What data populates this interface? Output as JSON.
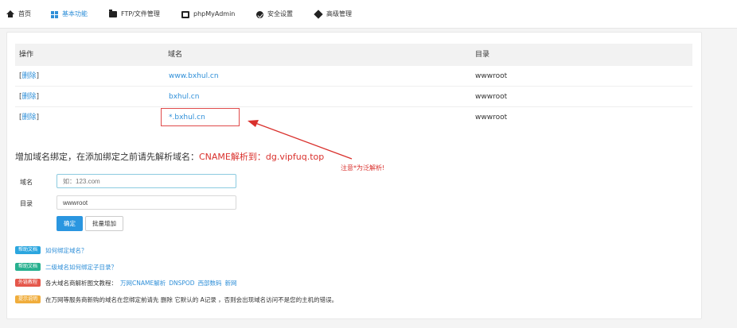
{
  "nav": {
    "items": [
      {
        "label": "首页",
        "icon": "home-icon"
      },
      {
        "label": "基本功能",
        "icon": "grid-icon",
        "active": true
      },
      {
        "label": "FTP/文件管理",
        "icon": "folder-icon"
      },
      {
        "label": "phpMyAdmin",
        "icon": "database-icon"
      },
      {
        "label": "安全设置",
        "icon": "shield-icon"
      },
      {
        "label": "高级管理",
        "icon": "layers-icon"
      }
    ]
  },
  "table": {
    "headers": [
      "操作",
      "域名",
      "目录"
    ],
    "rows": [
      {
        "action": "删除",
        "domain": "www.bxhul.cn",
        "dir": "wwwroot"
      },
      {
        "action": "删除",
        "domain": "bxhul.cn",
        "dir": "wwwroot"
      },
      {
        "action": "删除",
        "domain": "*.bxhul.cn",
        "dir": "wwwroot"
      }
    ]
  },
  "notice": {
    "prefix": "增加域名绑定，在添加绑定之前请先解析域名：",
    "highlight": "CNAME解析到：dg.vipfuq.top"
  },
  "annotation": {
    "text": "注意*为泛解析!"
  },
  "form": {
    "domain_label": "域名",
    "domain_placeholder": "如：123.com",
    "dir_label": "目录",
    "dir_value": "wwwroot",
    "confirm_label": "确定",
    "batch_label": "批量增加"
  },
  "help": [
    {
      "badge": "帮助文档",
      "badge_color": "#2ba6df",
      "parts": [
        {
          "type": "link",
          "text": "如何绑定域名？"
        }
      ]
    },
    {
      "badge": "帮助文档",
      "badge_color": "#27b08f",
      "parts": [
        {
          "type": "link",
          "text": "二级域名如何绑定子目录？"
        }
      ]
    },
    {
      "badge": "外链教程",
      "badge_color": "#e5574b",
      "parts": [
        {
          "type": "text",
          "text": "各大域名商解析图文教程："
        },
        {
          "type": "link",
          "text": "万网CNAME解析"
        },
        {
          "type": "link",
          "text": "DNSPOD"
        },
        {
          "type": "link",
          "text": "西部数码"
        },
        {
          "type": "link",
          "text": "新网"
        }
      ]
    },
    {
      "badge": "提示说明",
      "badge_color": "#f0ad3c",
      "parts": [
        {
          "type": "text",
          "text": "在万网等服务商新购的域名在您绑定前请先 删除 它默认的 A记录 ，否则会出现域名访问不是您的主机的错误。"
        }
      ]
    }
  ],
  "colors": {
    "accent": "#2f8fd8",
    "warning_red": "#d9302c",
    "primary_button": "#2a96e0"
  }
}
